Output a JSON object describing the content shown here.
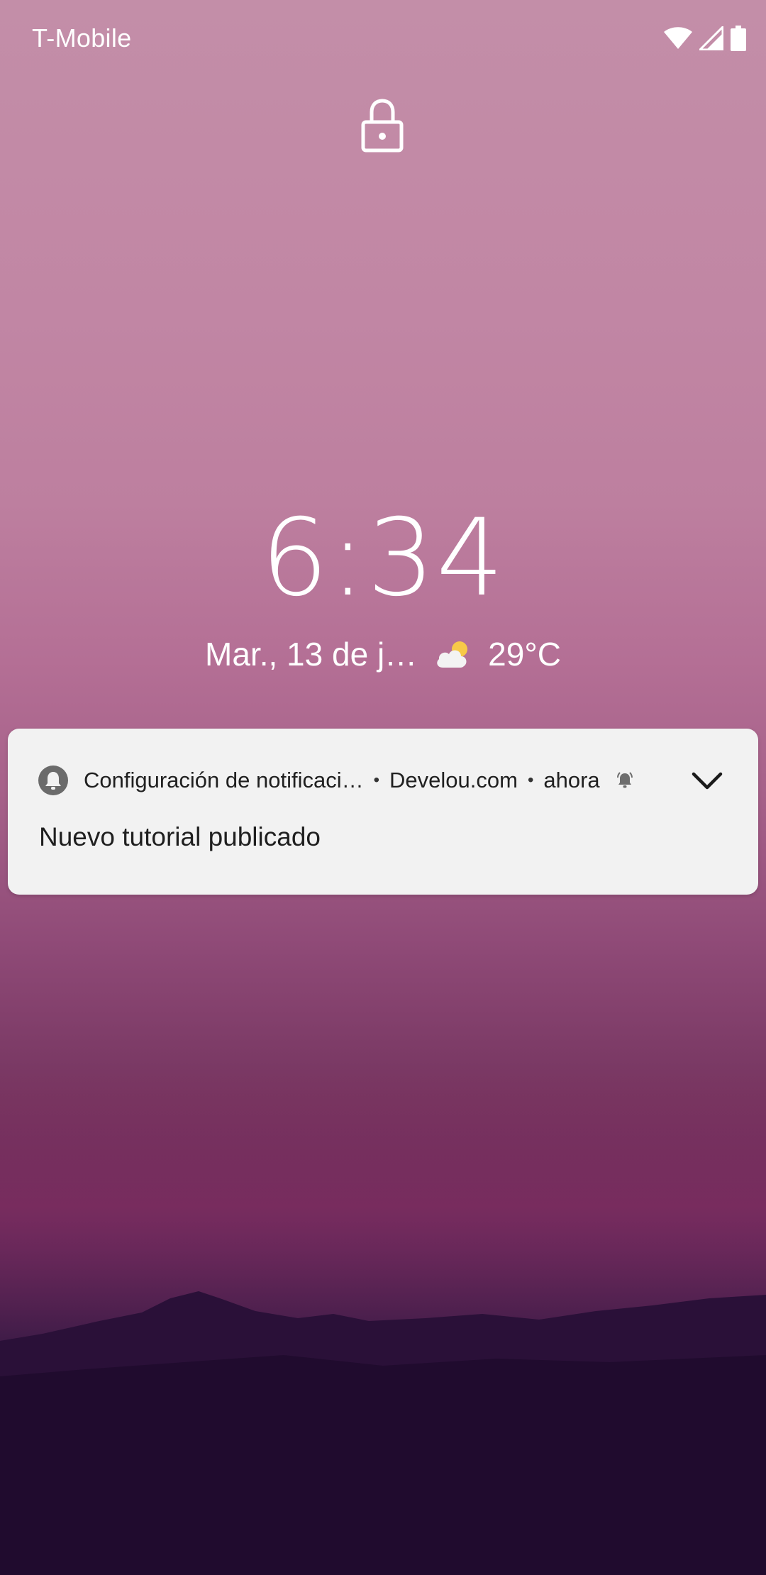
{
  "status_bar": {
    "carrier": "T-Mobile",
    "icons": [
      "wifi-icon",
      "cell-signal-icon",
      "battery-icon"
    ]
  },
  "lock_screen": {
    "lock_icon": "lock-icon",
    "time": "6:34",
    "date": "Mar., 13 de j…",
    "weather_icon": "partly-cloudy-icon",
    "temperature": "29°C"
  },
  "notification": {
    "app_icon": "bell-icon",
    "app_name": "Configuración de notificaci…",
    "separator": "•",
    "source": "Develou.com",
    "time": "ahora",
    "alert_icon": "bell-ringing-icon",
    "expand_icon": "chevron-down-icon",
    "text": "Nuevo tutorial publicado"
  },
  "colors": {
    "notification_bg": "#f2f2f2",
    "sky_top": "#c38ea8",
    "sky_bottom": "#1f0d2e"
  }
}
